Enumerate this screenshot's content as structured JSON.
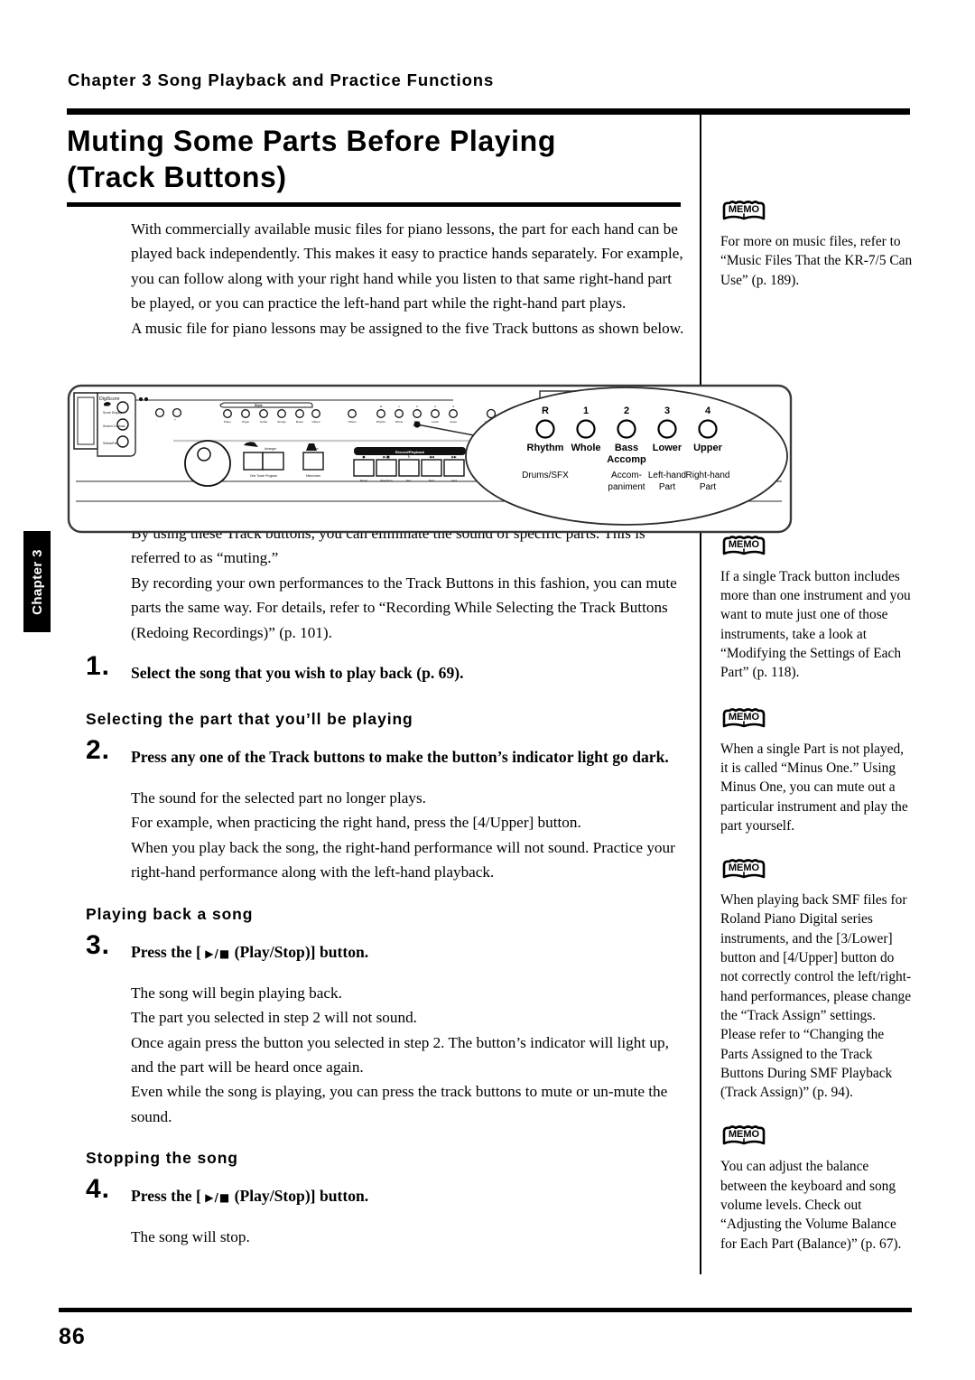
{
  "chapter_tab": {
    "label": "Chapter 3"
  },
  "header": {
    "running_head": "Chapter 3 Song Playback and Practice Functions",
    "title_line1": "Muting Some Parts Before Playing",
    "title_line2": "(Track Buttons)"
  },
  "main": {
    "intro_paragraph": "With commercially available music files for piano lessons, the part for each hand can be played back independently. This makes it easy to practice hands separately. For example, you can follow along with your right hand while you listen to that same right-hand part be played, or you can practice the left-hand part while the right-hand part plays.",
    "intro_paragraph2": "A music file for piano lessons may be assigned to the five Track buttons as shown below.",
    "para_muting": "By using these Track buttons, you can eliminate the sound of specific parts. This is referred to as “muting.”",
    "para_recording": "By recording your own performances to the Track Buttons in this fashion, you can mute parts the same way. For details, refer to “Recording While Selecting the Track Buttons (Redoing Recordings)” (p. 101).",
    "step1": {
      "number": "1.",
      "text": "Select the song that you wish to play back (p. 69)."
    },
    "subhead_selecting": "Selecting the part that you’ll be playing",
    "step2": {
      "number": "2.",
      "text": "Press any one of the Track buttons to make the button’s indicator light go dark."
    },
    "step2_note1": "The sound for the selected part no longer plays.",
    "step2_note2": "For example, when practicing the right hand, press the [4/Upper] button.",
    "step2_note3": "When you play back the song, the right-hand performance will not sound. Practice your right-hand performance along with the left-hand playback.",
    "subhead_playing": "Playing back a song",
    "step3": {
      "number": "3.",
      "prefix": "Press the [",
      "glyph": "▶/■",
      "suffix": "(Play/Stop)] button."
    },
    "step3_note1": "The song will begin playing back.",
    "step3_note2": "The part you selected in step 2 will not sound.",
    "step3_note3": "Once again press the button you selected in step 2. The button’s indicator will light up, and the part will be heard once again.",
    "step3_note4": "Even while the song is playing, you can press the track buttons to mute or un-mute the sound.",
    "subhead_stopping": "Stopping the song",
    "step4": {
      "number": "4.",
      "prefix": "Press the [",
      "glyph": "▶/■",
      "suffix": "(Play/Stop)] button."
    },
    "step4_note1": "The song will stop."
  },
  "diagram": {
    "callout_columns": [
      {
        "number": "R",
        "name": "Rhythm",
        "name2": "",
        "desc1": "Drums/SFX",
        "desc2": ""
      },
      {
        "number": "1",
        "name": "Whole",
        "name2": "",
        "desc1": "",
        "desc2": ""
      },
      {
        "number": "2",
        "name": "Bass",
        "name2": "Accomp",
        "desc1": "Accom-",
        "desc2": "paniment"
      },
      {
        "number": "3",
        "name": "Lower",
        "name2": "",
        "desc1": "Left-hand",
        "desc2": "Part"
      },
      {
        "number": "4",
        "name": "Upper",
        "name2": "",
        "desc1": "Right-hand",
        "desc2": "Part"
      }
    ],
    "panel_brand": "DigiScore",
    "panel_strip_label": "Record/Playback",
    "panel_section_label": "Style"
  },
  "sidebar": {
    "memo_icon_label": "MEMO",
    "memos": [
      {
        "text": "For more on music files, refer to “Music Files That the KR-7/5 Can Use” (p. 189)."
      },
      {
        "text": "If a single Track button includes more than one instrument and you want to mute just one of those instruments, take a look at “Modifying the Settings of Each Part” (p. 118)."
      },
      {
        "text": "When a single Part is not played, it is called “Minus One.” Using Minus One, you can mute out a particular instrument and play the part yourself."
      },
      {
        "text": "When playing back SMF files for Roland Piano Digital series instruments, and the [3/Lower] button and [4/Upper] button do not correctly control the left/right-hand performances, please change the “Track Assign” settings. Please refer to “Changing the Parts Assigned to the Track Buttons During SMF Playback (Track Assign)” (p. 94)."
      },
      {
        "text": "You can adjust the balance between the keyboard and song volume levels. Check out “Adjusting the Volume Balance for Each Part (Balance)” (p. 67)."
      }
    ]
  },
  "footer": {
    "page_number": "86"
  }
}
